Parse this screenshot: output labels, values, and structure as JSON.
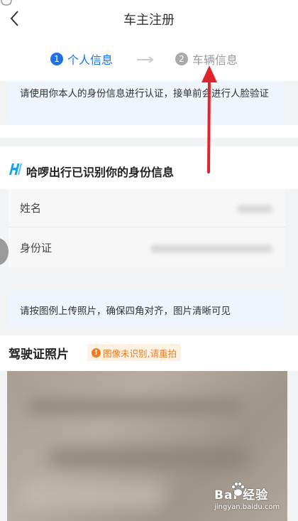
{
  "header": {
    "title": "车主注册"
  },
  "steps": [
    {
      "num": "1",
      "label": "个人信息"
    },
    {
      "num": "2",
      "label": "车辆信息"
    }
  ],
  "notice_verify": "请使用你本人的身份信息进行认证，接单前会进行人脸验证",
  "identity": {
    "title": "哈啰出行已识别你的身份信息",
    "name_label": "姓名",
    "id_label": "身份证"
  },
  "notice_upload": "请按图例上传照片，确保四角对齐，图片清晰可见",
  "license": {
    "title": "驾驶证照片",
    "warning": "图像未识别,请重拍",
    "warning_icon": "!"
  },
  "watermark": {
    "brand": "Bai  经验",
    "url": "jingyan.baidu.com"
  },
  "colors": {
    "accent": "#1a73e8",
    "warning": "#e67e22",
    "annotation_arrow": "#e0242b"
  }
}
